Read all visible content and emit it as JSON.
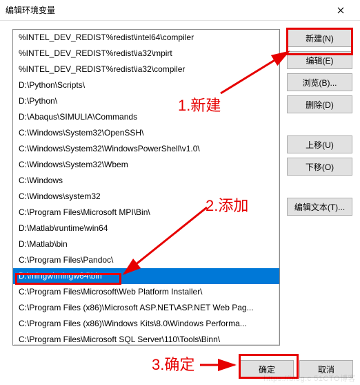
{
  "titlebar": {
    "title": "编辑环境变量"
  },
  "list": {
    "items": [
      "%INTEL_DEV_REDIST%redist\\intel64\\compiler",
      "%INTEL_DEV_REDIST%redist\\ia32\\mpirt",
      "%INTEL_DEV_REDIST%redist\\ia32\\compiler",
      "D:\\Python\\Scripts\\",
      "D:\\Python\\",
      "D:\\Abaqus\\SIMULIA\\Commands",
      "C:\\Windows\\System32\\OpenSSH\\",
      "C:\\Windows\\System32\\WindowsPowerShell\\v1.0\\",
      "C:\\Windows\\System32\\Wbem",
      "C:\\Windows",
      "C:\\Windows\\system32",
      "C:\\Program Files\\Microsoft MPI\\Bin\\",
      "D:\\Matlab\\runtime\\win64",
      "D:\\Matlab\\bin",
      "C:\\Program Files\\Pandoc\\",
      "D:\\mingw\\mingw64\\bin",
      "C:\\Program Files\\Microsoft\\Web Platform Installer\\",
      "C:\\Program Files (x86)\\Microsoft ASP.NET\\ASP.NET Web Pag...",
      "C:\\Program Files (x86)\\Windows Kits\\8.0\\Windows Performa...",
      "C:\\Program Files\\Microsoft SQL Server\\110\\Tools\\Binn\\"
    ],
    "selected_index": 15
  },
  "buttons": {
    "new": "新建(N)",
    "edit": "编辑(E)",
    "browse": "浏览(B)...",
    "delete": "删除(D)",
    "moveup": "上移(U)",
    "movedown": "下移(O)",
    "edittext": "编辑文本(T)..."
  },
  "footer": {
    "ok": "确定",
    "cancel": "取消"
  },
  "annotations": {
    "step1": "1.新建",
    "step2": "2.添加",
    "step3": "3.确定"
  },
  "watermark": "https://blog.c 51CTO博客"
}
